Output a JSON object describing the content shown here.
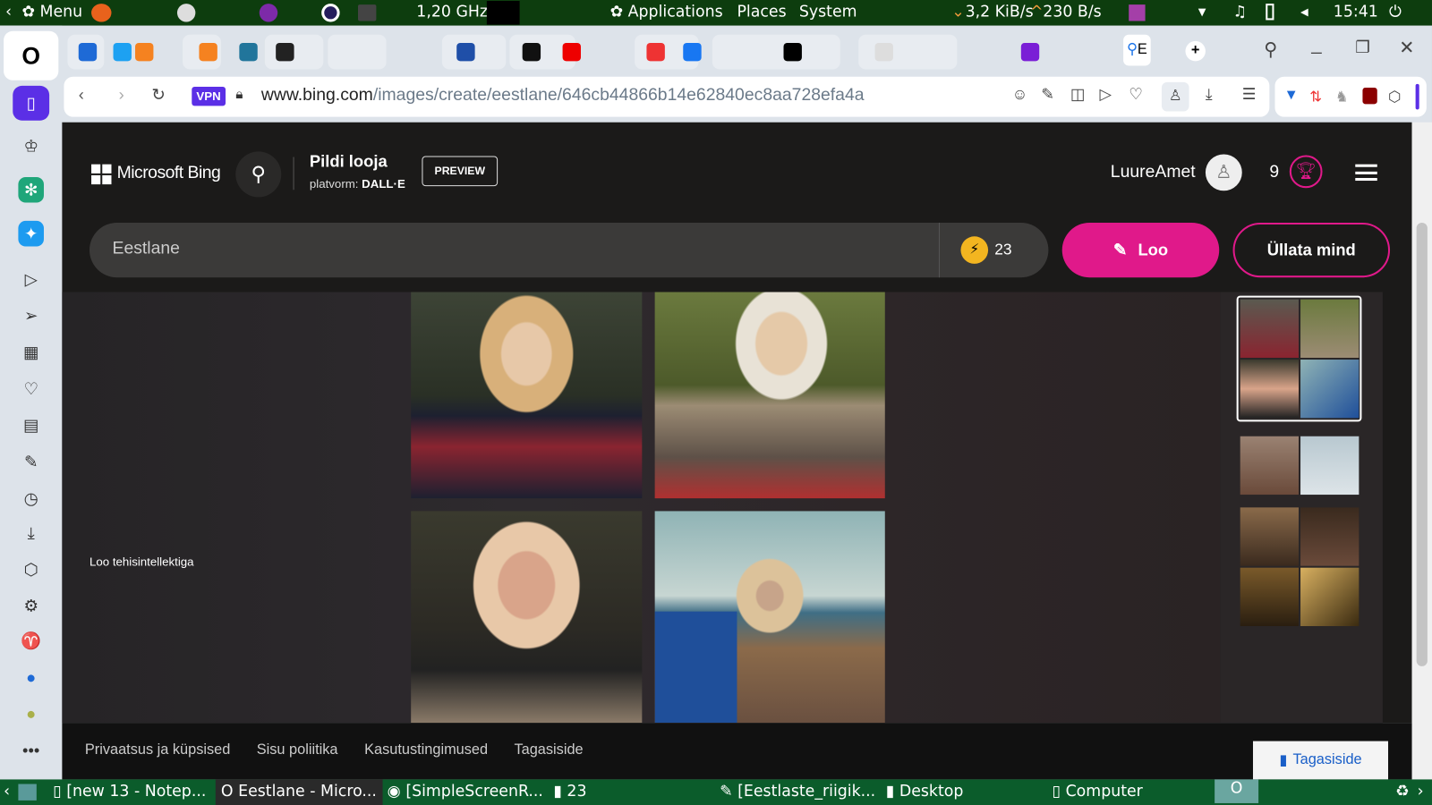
{
  "system_bar": {
    "menu": "Menu",
    "cpu": "1,20 GHz",
    "applications": "Applications",
    "places": "Places",
    "system": "System",
    "net_down": "3,2 KiB/s",
    "net_up": "230 B/s",
    "clock": "15:41"
  },
  "browser": {
    "url_host": "www.bing.com",
    "url_path": "/images/create/eestlane/646cb44866b14e62840ec8aa728efa4a",
    "vpn": "VPN",
    "active_tab_letter": "E"
  },
  "bing": {
    "brand": "Microsoft Bing",
    "product_title": "Pildi looja",
    "platform_label": "platvorm: ",
    "platform_value": "DALL·E",
    "preview": "PREVIEW",
    "username": "LuureAmet",
    "rewards_count": "9",
    "prompt": "Eestlane",
    "boosts": "23",
    "create_button": "Loo",
    "surprise_button": "Üllata mind",
    "side_caption": "Loo tehisintellektiga"
  },
  "footer": {
    "links": [
      "Privaatsus ja küpsised",
      "Sisu poliitika",
      "Kasutustingimused",
      "Tagasiside"
    ],
    "feedback_button": "Tagasiside"
  },
  "taskbar": {
    "items": [
      "[new 13 - Notep...",
      "Eestlane - Micro...",
      "[SimpleScreenR...",
      "23",
      "[Eestlaste_riigik...",
      "Desktop",
      "Computer"
    ]
  },
  "colors": {
    "accent": "#e0198a",
    "page_bg": "#1b1a19",
    "panel_bg": "#0d3d0e"
  }
}
